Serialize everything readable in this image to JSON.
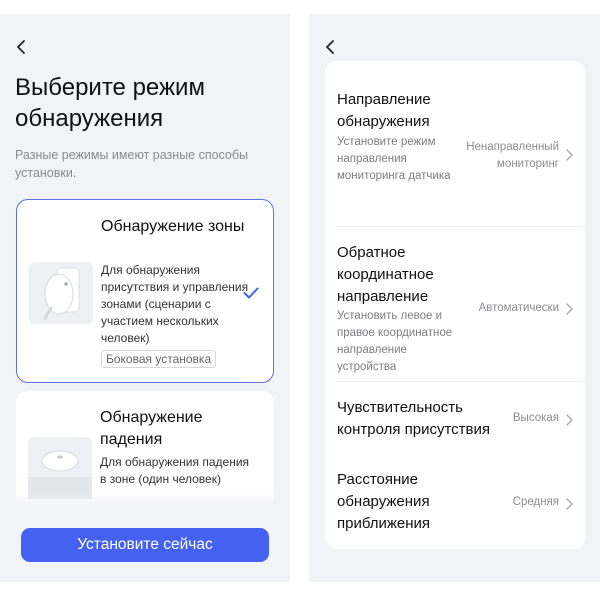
{
  "left": {
    "heading": "Выберите режим обнаружения",
    "subheading": "Разные режимы имеют разные способы установки.",
    "modes": [
      {
        "title": "Обнаружение зоны",
        "description": "Для обнаружения присутствия и управления зонами (сценарии с участием нескольких человек)",
        "tag": "Боковая установка",
        "selected": true,
        "image_icon": "wall-mounted-sensor-icon"
      },
      {
        "title": "Обнаружение падения",
        "description": "Для обнаружения падения в зоне (один человек)",
        "selected": false,
        "image_icon": "ceiling-sensor-icon"
      }
    ],
    "install_button": "Установите сейчас"
  },
  "right": {
    "settings": [
      {
        "title": "Направление обнаружения",
        "description": "Установите режим направления мониторинга датчика",
        "value": "Ненаправленный мониторинг"
      },
      {
        "title": "Обратное координатное направление",
        "description": "Установить левое и правое координатное направление устройства",
        "value": "Автоматически"
      },
      {
        "title": "Чувствительность контроля присутствия",
        "value": "Высокая"
      },
      {
        "title": "Расстояние обнаружения приближения",
        "value": "Средняя"
      }
    ]
  },
  "colors": {
    "accent": "#4561f2",
    "selected_border": "#5c6ef0",
    "panel_background": "#f2f3f7"
  }
}
